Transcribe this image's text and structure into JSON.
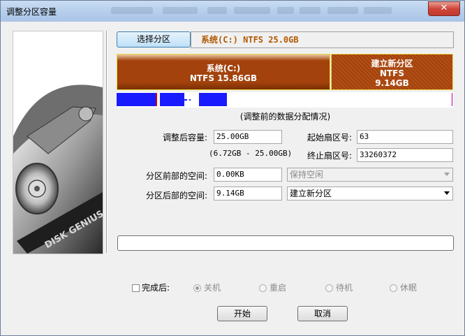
{
  "window": {
    "title": "调整分区容量",
    "close_glyph": "✕"
  },
  "select_partition_button": "选择分区",
  "partition_info": "系统(C:) NTFS 25.0GB",
  "partition_bar": {
    "left": {
      "name": "系统(C:)",
      "detail": "NTFS 15.86GB",
      "fill_fraction": 0.63
    },
    "right": {
      "name": "建立新分区",
      "fs": "NTFS",
      "size": "9.14GB",
      "fill_fraction": 0.37
    }
  },
  "usage_caption": "(调整前的数据分配情况)",
  "form": {
    "new_size_label": "调整后容量:",
    "new_size_value": "25.00GB",
    "size_range": "(6.72GB - 25.00GB)",
    "start_sector_label": "起始扇区号:",
    "start_sector_value": "63",
    "end_sector_label": "终止扇区号:",
    "end_sector_value": "33260372",
    "before_space_label": "分区前部的空间:",
    "before_space_value": "0.00KB",
    "before_space_option": "保持空闲",
    "after_space_label": "分区后部的空间:",
    "after_space_value": "9.14GB",
    "after_space_option": "建立新分区"
  },
  "completion": {
    "label": "完成后:",
    "options": [
      "关机",
      "重启",
      "待机",
      "休眠"
    ]
  },
  "buttons": {
    "start": "开始",
    "cancel": "取消"
  },
  "colors": {
    "partition_fill": "#a3420c",
    "partition_border": "#e7d74a",
    "usage_blue": "#1a1aff",
    "info_text": "#b05800"
  },
  "logo_text": "DISK GENIUS"
}
